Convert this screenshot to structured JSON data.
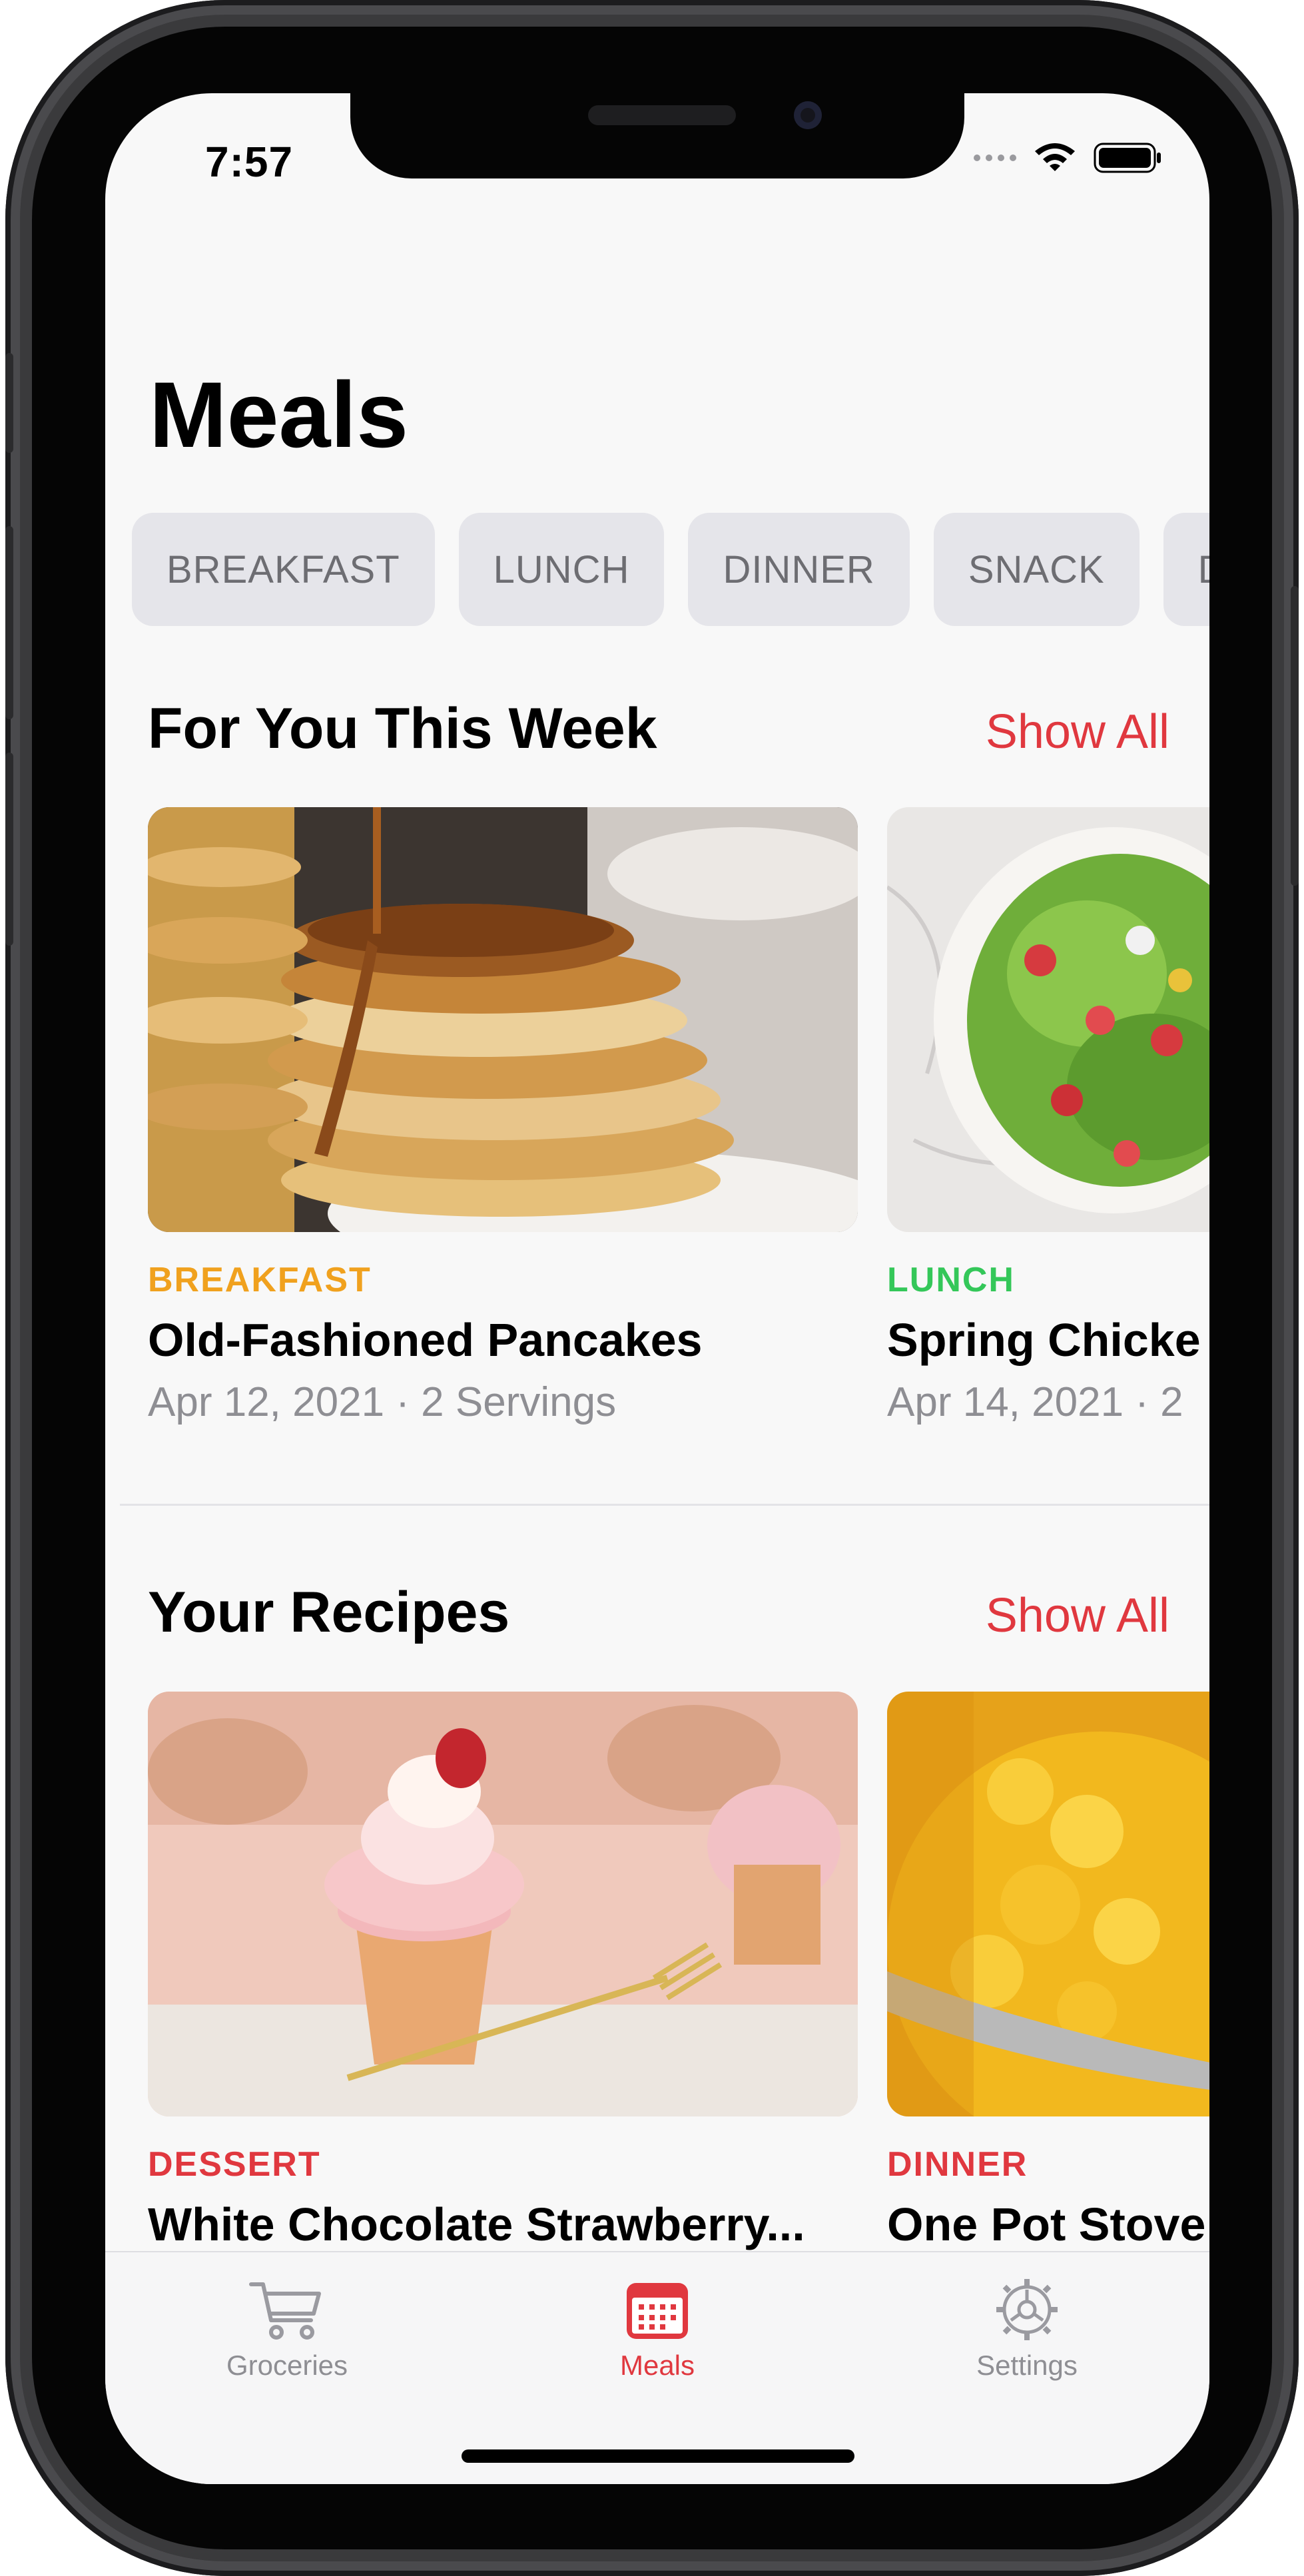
{
  "status_bar": {
    "time": "7:57"
  },
  "page_title": "Meals",
  "chips": [
    "BREAKFAST",
    "LUNCH",
    "DINNER",
    "SNACK",
    "D"
  ],
  "for_you": {
    "title": "For You This Week",
    "show_all": "Show All",
    "cards": [
      {
        "category": "BREAKFAST",
        "category_color": "#f0a11e",
        "title": "Old-Fashioned Pancakes",
        "meta": "Apr 12, 2021 · 2 Servings"
      },
      {
        "category": "LUNCH",
        "category_color": "#34c759",
        "title": "Spring Chicke",
        "meta": "Apr 14, 2021 · 2"
      }
    ]
  },
  "your_recipes": {
    "title": "Your Recipes",
    "show_all": "Show All",
    "cards": [
      {
        "category": "DESSERT",
        "category_color": "#e0383f",
        "title": "White Chocolate Strawberry...",
        "meta": ""
      },
      {
        "category": "DINNER",
        "category_color": "#e0383f",
        "title": "One Pot Stove",
        "meta": ""
      }
    ]
  },
  "tab_bar": {
    "tabs": [
      {
        "label": "Groceries",
        "icon": "cart-icon",
        "active": false
      },
      {
        "label": "Meals",
        "icon": "calendar-icon",
        "active": true
      },
      {
        "label": "Settings",
        "icon": "gear-icon",
        "active": false
      }
    ]
  },
  "colors": {
    "accent": "#e0383f",
    "inactive": "#8e8e93",
    "chip_bg": "#e5e5ea"
  }
}
